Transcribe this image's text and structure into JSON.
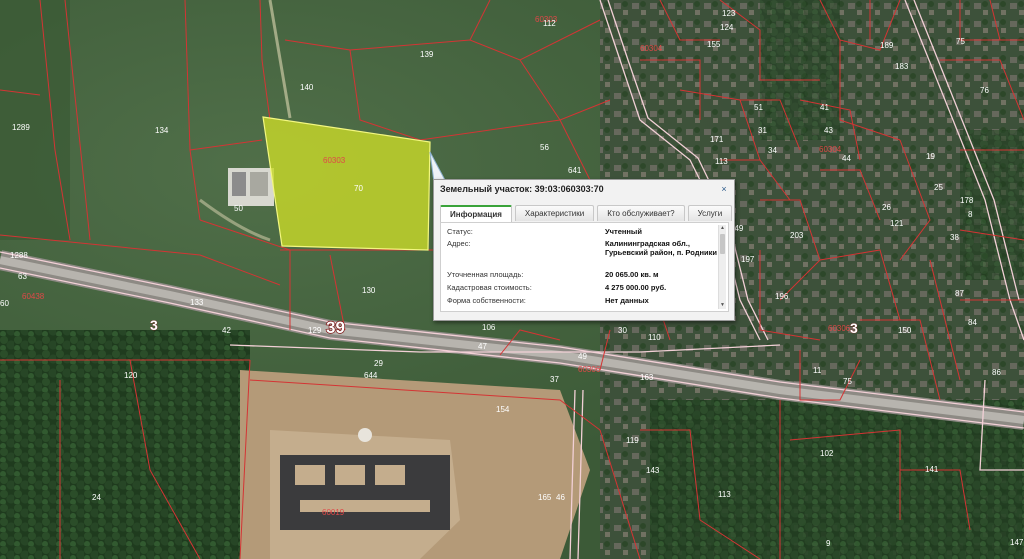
{
  "map": {
    "colors": {
      "aerial_dark": "#2d4a2a",
      "aerial_field": "#4b6b45",
      "boundary_red": "#d43434",
      "road_pink": "#f2d0d6",
      "highlight_fill": "#c7d82a"
    },
    "highlight": {
      "quarter": "60303",
      "parcel": "70"
    },
    "road_numbers": [
      "39",
      "3",
      "3"
    ],
    "quarter_labels": [
      "60304",
      "60304",
      "60306",
      "60306",
      "60438",
      "60019",
      "60303"
    ],
    "parcel_labels": [
      "139",
      "140",
      "134",
      "112",
      "1289",
      "56",
      "641",
      "50",
      "1288",
      "63",
      "60",
      "130",
      "133",
      "129",
      "42",
      "106",
      "47",
      "30",
      "110",
      "49",
      "37",
      "163",
      "644",
      "29",
      "154",
      "120",
      "119",
      "143",
      "24",
      "165",
      "46",
      "113",
      "102",
      "141",
      "147",
      "123",
      "155",
      "124",
      "189",
      "183",
      "75",
      "76",
      "171",
      "113",
      "51",
      "31",
      "34",
      "43",
      "41",
      "44",
      "150",
      "149",
      "197",
      "203",
      "196",
      "26",
      "121",
      "87",
      "84",
      "86",
      "150",
      "11",
      "75",
      "9",
      "8",
      "38",
      "178",
      "25",
      "19"
    ]
  },
  "popup": {
    "title": "Земельный участок: 39:03:060303:70",
    "close_symbol": "×",
    "tabs": [
      "Информация",
      "Характеристики",
      "Кто обслуживает?",
      "Услуги"
    ],
    "rows": [
      {
        "key": "Статус:",
        "value": "Учтенный"
      },
      {
        "key": "Адрес:",
        "value": "Калининградская обл., Гурьевский район, п. Родники"
      },
      {
        "key": "Уточненная площадь:",
        "value": "20 065.00 кв. м"
      },
      {
        "key": "Кадастровая стоимость:",
        "value": "4 275 000.00 руб."
      },
      {
        "key": "Форма собственности:",
        "value": "Нет данных"
      }
    ],
    "icons": {
      "close": "close-icon",
      "scroll_up": "chevron-up-icon",
      "scroll_down": "chevron-down-icon"
    }
  }
}
